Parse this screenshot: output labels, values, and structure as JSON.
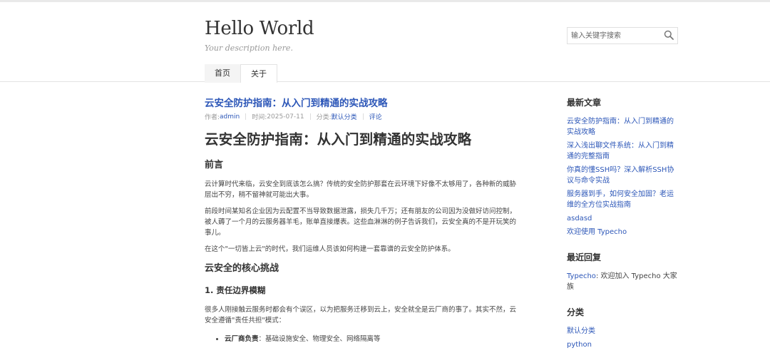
{
  "site": {
    "title": "Hello World",
    "description": "Your description here."
  },
  "search": {
    "placeholder": "输入关键字搜索",
    "icon": "search-icon"
  },
  "nav": {
    "items": [
      {
        "label": "首页"
      },
      {
        "label": "关于"
      }
    ]
  },
  "post": {
    "title": "云安全防护指南：从入门到精通的实战攻略",
    "meta": {
      "author_prefix": "作者: ",
      "author": "admin",
      "time_prefix": "时间: ",
      "time": "2025-07-11",
      "category_prefix": "分类: ",
      "category": "默认分类",
      "comments": "评论"
    },
    "h1": "云安全防护指南：从入门到精通的实战攻略",
    "h2_preface": "前言",
    "p1": "云计算时代来临，云安全到底该怎么搞？传统的安全防护那套在云环境下好像不太够用了，各种新的威胁层出不穷，稍不留神就可能出大事。",
    "p2": "前段时间某知名企业因为云配置不当导致数据泄露，损失几千万；还有朋友的公司因为没做好访问控制，被人薅了一个月的云服务器羊毛，账单直接爆表。这些血淋淋的例子告诉我们，云安全真的不是开玩笑的事儿。",
    "p3": "在这个\"一切皆上云\"的时代，我们运维人员该如何构建一套靠谱的云安全防护体系。",
    "h2_challenges": "云安全的核心挑战",
    "h3_boundary": "1. 责任边界模糊",
    "p4": "很多人刚接触云服务时都会有个误区，以为把服务迁移到云上，安全就全是云厂商的事了。其实不然，云安全遵循\"责任共担\"模式：",
    "li1_bold": "云厂商负责",
    "li1_text": "：基础设施安全、物理安全、网络隔离等"
  },
  "sidebar": {
    "recent_posts": {
      "title": "最新文章",
      "items": [
        "云安全防护指南：从入门到精通的实战攻略",
        "深入浅出聊文件系统：从入门到精通的完整指南",
        "你真的懂SSH吗？深入解析SSH协议与命令实战",
        "服务器到手，如何安全加固？老运维的全方位实战指南",
        "asdasd",
        "欢迎使用 Typecho"
      ]
    },
    "recent_comments": {
      "title": "最近回复",
      "items": [
        {
          "author": "Typecho",
          "text": ": 欢迎加入 Typecho 大家族"
        }
      ]
    },
    "categories": {
      "title": "分类",
      "items": [
        "默认分类",
        "python"
      ]
    }
  },
  "colors": {
    "link": "#2d57b8",
    "text": "#444444",
    "heading": "#333333",
    "muted": "#999999"
  }
}
